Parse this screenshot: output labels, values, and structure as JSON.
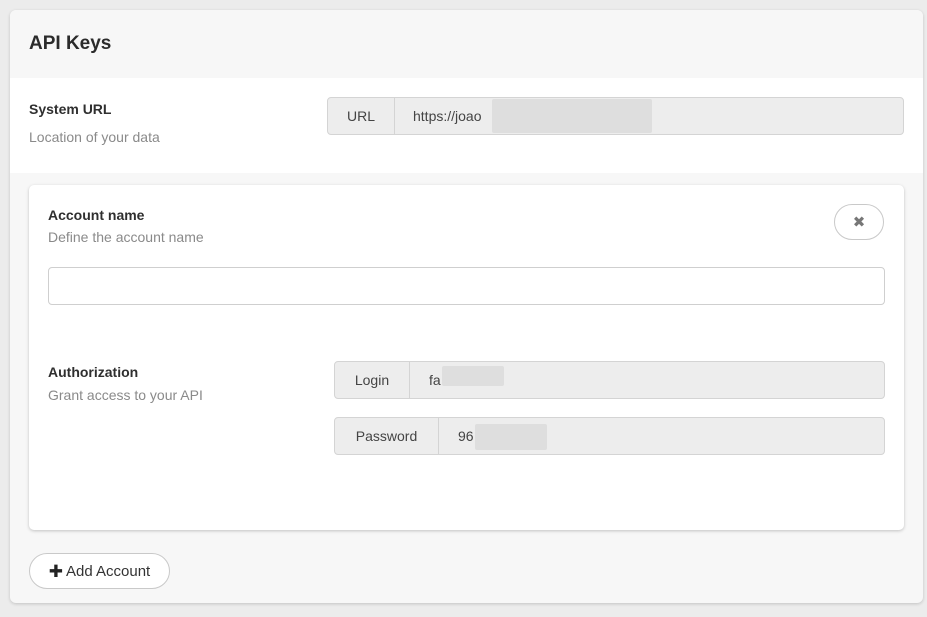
{
  "panel": {
    "title": "API Keys"
  },
  "system_url": {
    "label": "System URL",
    "description": "Location of your data",
    "addon": "URL",
    "value": "https://joao"
  },
  "account": {
    "name_label": "Account name",
    "name_description": "Define the account name",
    "name_value": "",
    "remove_icon": "close-icon",
    "auth_label": "Authorization",
    "auth_description": "Grant access to your API",
    "login_addon": "Login",
    "login_value": "fa",
    "password_addon": "Password",
    "password_value": "96"
  },
  "actions": {
    "add_icon": "plus-icon",
    "add_label": "Add Account"
  }
}
